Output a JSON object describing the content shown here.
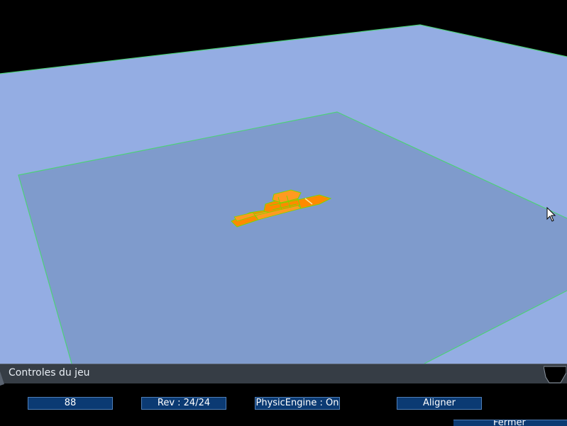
{
  "scene": {
    "colors": {
      "background": "#000000",
      "outer_ground": "#94ade3",
      "inner_ground": "#7f9bcc",
      "grid_edge": "#4ecf7a",
      "model_primary": "#ff8a00",
      "model_secondary": "#7fd400"
    }
  },
  "panel": {
    "title": "Controles du jeu",
    "collapse_icon": "chevron-down-icon",
    "buttons": {
      "score": "88",
      "revision": "Rev : 24/24",
      "physic_engine": "PhysicEngine : On",
      "align": "Aligner"
    },
    "close_label": "Fermer"
  },
  "cursor": {
    "icon": "mouse-pointer-icon"
  }
}
